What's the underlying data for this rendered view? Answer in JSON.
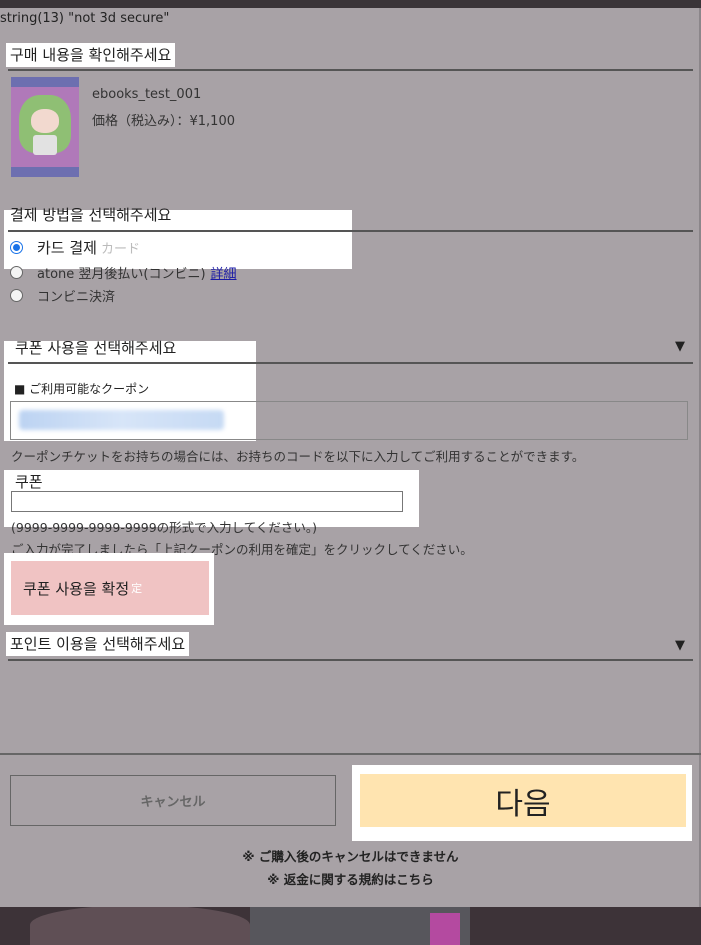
{
  "debug_text": "string(13) \"not 3d secure\"",
  "purchase": {
    "title": "구매 내용을 확인해주세요",
    "product_name": "ebooks_test_001",
    "price": "価格（税込み）：¥1,100"
  },
  "payment": {
    "title": "결제 방법을 선택해주세요",
    "options": [
      {
        "label": "카드 결제",
        "ghost": "カード",
        "checked": true
      },
      {
        "label": "atone 翌月後払い(コンビニ)",
        "link": "詳細",
        "checked": false
      },
      {
        "label": "コンビニ決済",
        "checked": false
      }
    ]
  },
  "coupon": {
    "title": "쿠폰 사용을 선택해주세요",
    "caret": "▼",
    "available_label": "■ ご利用可能なクーポン",
    "description": "クーポンチケットをお持ちの場合には、お持ちのコードを以下に入力してご利用することができます。",
    "field_label": "쿠폰",
    "input_value": "",
    "hint": "(9999-9999-9999-9999の形式で入力してください。)",
    "hint2": "ご入力が完了しましたら「上記クーポンの利用を確定」をクリックしてください。",
    "confirm_label": "쿠폰 사용을 확정",
    "confirm_ghost": "定"
  },
  "points": {
    "title": "포인트 이용을 선택해주세요",
    "caret": "▼"
  },
  "footer": {
    "cancel_label": "キャンセル",
    "next_label": "다음",
    "notice1": "※ ご購入後のキャンセルはできません",
    "notice2": "※ 返金に関する規約はこちら"
  }
}
